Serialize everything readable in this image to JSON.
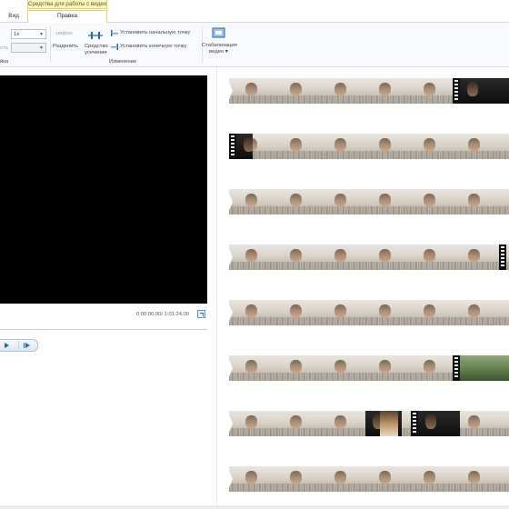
{
  "ribbon": {
    "context_tab_band": "Средства для работы с видео",
    "tabs": [
      {
        "label": "Вид",
        "active": false
      },
      {
        "label": "Правка",
        "active": true
      }
    ],
    "speed_value": "1x",
    "duration_label_partial": "стъ",
    "duration_value": "",
    "split_label": "Разделить",
    "trim_icon_caption": "нефон",
    "trim_tool_line1": "Средство",
    "trim_tool_line2": "усечения",
    "set_start_point": "Установить начальную точку",
    "set_end_point": "Установить конечную точку",
    "group_left_partial": "йка",
    "group_edit": "Изменение",
    "stabilization_line1": "Стабилизация",
    "stabilization_line2": "видео ▾"
  },
  "preview": {
    "timecode": "0:00:00,00/ 1:01:24,00"
  },
  "storyboard": {
    "rows": 8,
    "thumbnail_subject": "person-selfie-in-white-room"
  },
  "colors": {
    "context_band": "#fbf6b7",
    "preview_bg": "#000000",
    "accent_blue": "#2b62a8"
  }
}
